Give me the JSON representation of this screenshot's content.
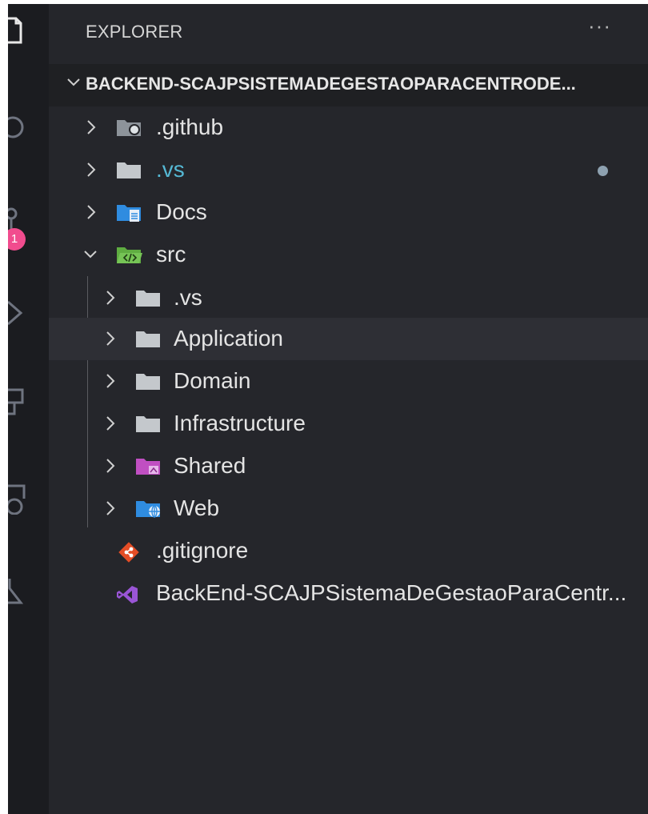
{
  "explorer": {
    "title": "EXPLORER",
    "more": "···",
    "folder_name": "BACKEND-SCAJPSISTEMADEGESTAOPARACENTRODE..."
  },
  "activity_bar": {
    "icons": [
      "files-icon",
      "search-icon",
      "source-control-icon",
      "run-debug-icon",
      "extensions-icon",
      "remote-explorer-icon",
      "testing-icon"
    ],
    "source_control_badge": "1"
  },
  "tree": {
    "github": ".github",
    "vs_root": ".vs",
    "docs": "Docs",
    "src": "src",
    "src_vs": ".vs",
    "application": "Application",
    "domain": "Domain",
    "infrastructure": "Infrastructure",
    "shared": "Shared",
    "web": "Web",
    "gitignore": ".gitignore",
    "solution": "BackEnd-SCAJPSistemaDeGestaoParaCentr..."
  },
  "colors": {
    "modified_text": "#55b8d4",
    "badge": "#f14c8e",
    "folder_gray": "#c4c8cc",
    "folder_blue": "#2f8ce0",
    "folder_green": "#5fad41",
    "folder_purple": "#c04fc2",
    "git_orange": "#e44d26",
    "vs_purple": "#9a55d6"
  }
}
